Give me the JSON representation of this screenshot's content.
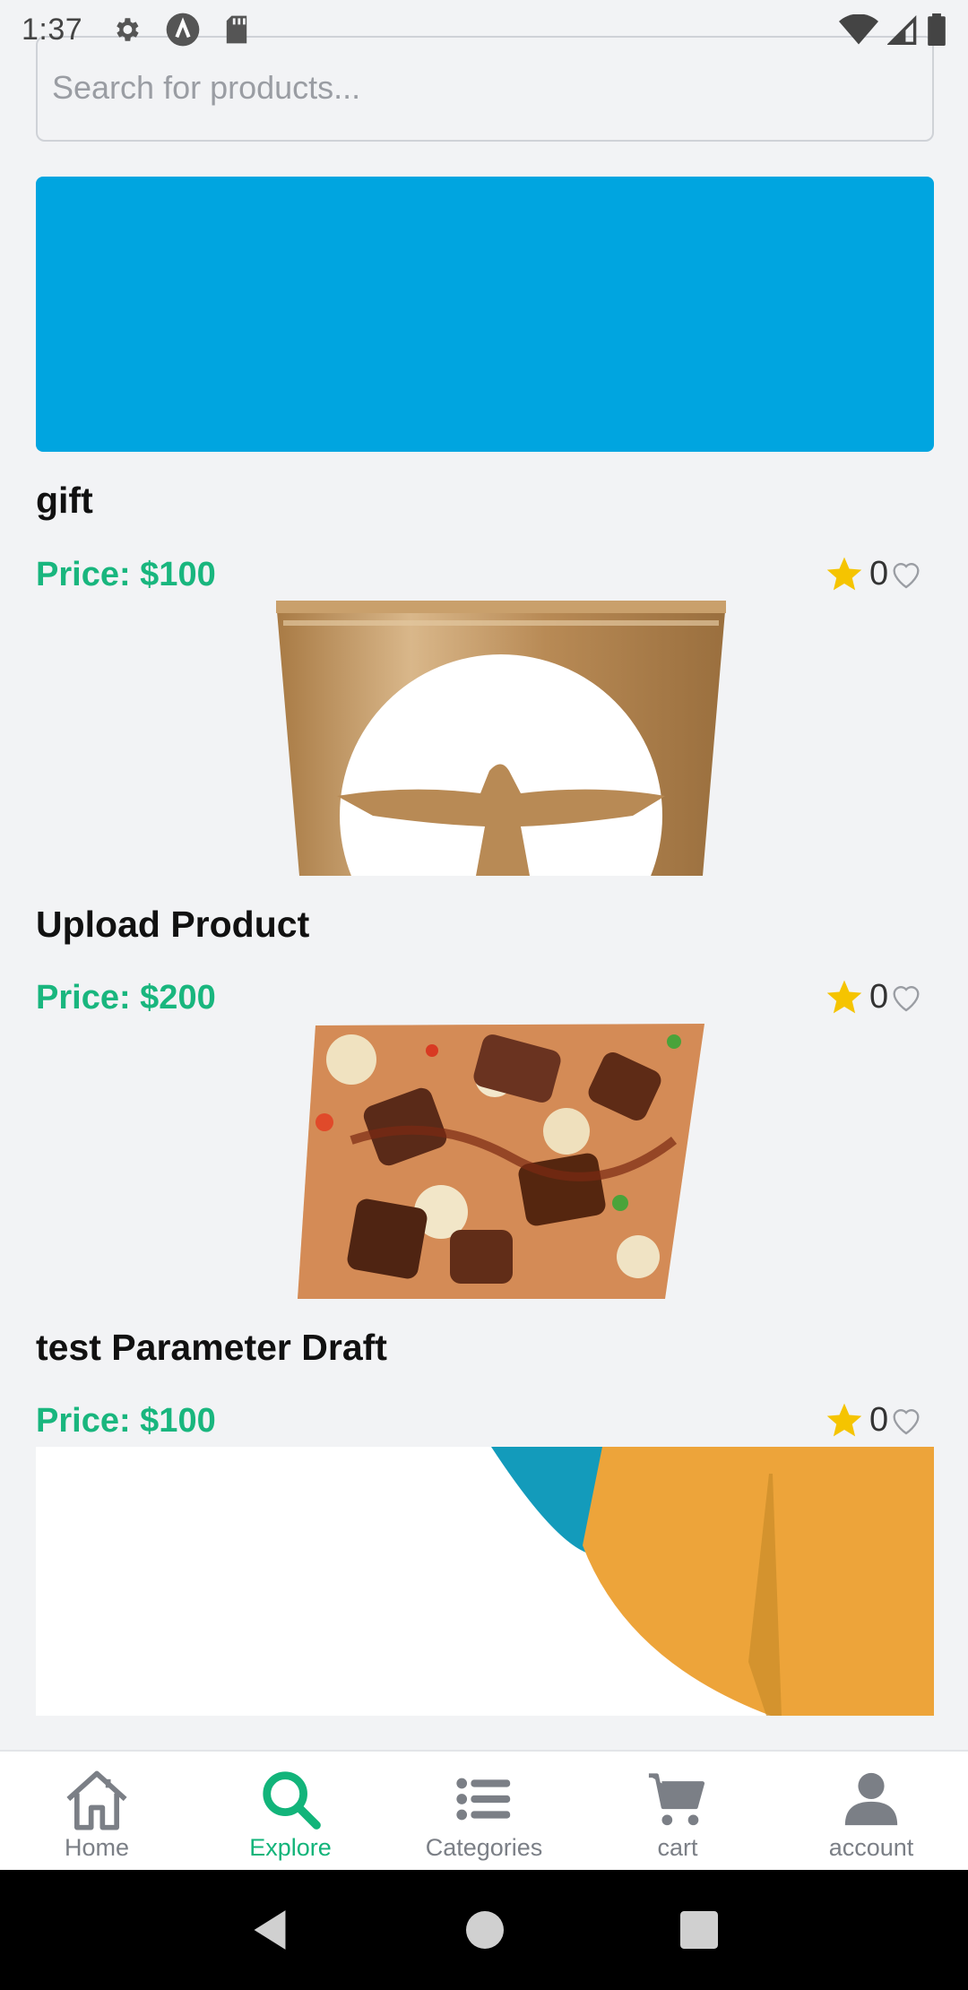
{
  "status_bar": {
    "time": "1:37"
  },
  "search": {
    "placeholder": "Search for products...",
    "value": ""
  },
  "colors": {
    "accent": "#12b47a",
    "price": "#19b67e",
    "banner": "#00a5e0",
    "star": "#f5c400"
  },
  "products": [
    {
      "name": "gift",
      "price": "Price: $100",
      "rating": "0",
      "image": "gold-cup-image"
    },
    {
      "name": "Upload Product",
      "price": "Price: $200",
      "rating": "0",
      "image": "pizza-image"
    },
    {
      "name": "test Parameter Draft",
      "price": "Price: $100",
      "rating": "0",
      "image": "abstract-graphic-image"
    }
  ],
  "bottom_nav": {
    "items": [
      {
        "label": "Home",
        "icon": "home-icon"
      },
      {
        "label": "Explore",
        "icon": "search-icon",
        "active": true
      },
      {
        "label": "Categories",
        "icon": "list-icon"
      },
      {
        "label": "cart",
        "icon": "cart-icon"
      },
      {
        "label": "account",
        "icon": "person-icon"
      }
    ]
  }
}
